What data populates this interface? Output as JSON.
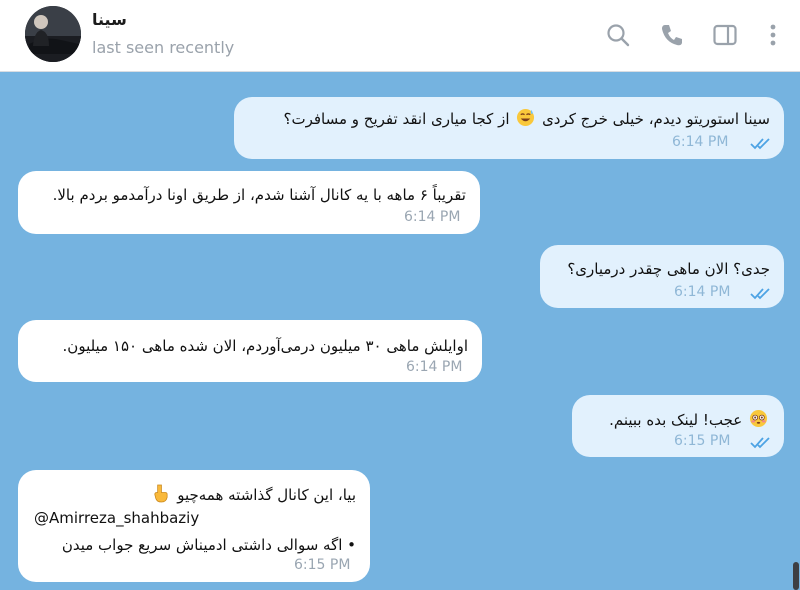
{
  "header": {
    "name": "سینا",
    "status": "last seen recently"
  },
  "messages": [
    {
      "id": "m1",
      "direction": "out",
      "text_before_emoji": "سینا استوریتو دیدم، خیلی خرج کردی",
      "emoji": "sweat-smile",
      "text_after_emoji": "از کجا میاری انقد تفریح و مسافرت؟",
      "time": "6:14 PM",
      "status": "read"
    },
    {
      "id": "m2",
      "direction": "in",
      "line1": "تقریباً ۶ ماهه با یه کانال آشنا شدم، از طریق اونا درآمدمو بردم بالا.",
      "time": "6:14 PM"
    },
    {
      "id": "m3",
      "direction": "out",
      "text": "جدی؟ الان ماهی چقدر درمیاری؟",
      "time": "6:14 PM",
      "status": "read"
    },
    {
      "id": "m4",
      "direction": "in",
      "text": "اوایلش ماهی ۳۰ میلیون درمی‌آوردم، الان شده ماهی ۱۵۰ میلیون.",
      "time": "6:14 PM"
    },
    {
      "id": "m5",
      "direction": "out",
      "emoji": "flushed-face",
      "text": "عجب! لینک بده ببینم.",
      "time": "6:15 PM",
      "status": "read"
    },
    {
      "id": "m6",
      "direction": "in",
      "line1": "بیا، این کانال گذاشته همه‌چیو",
      "emoji": "point-down",
      "link": "@Amirreza_shahbaziy",
      "line3": "• اگه سوالی داشتی ادمیناش سریع جواب میدن",
      "time": "6:15 PM"
    }
  ],
  "colors": {
    "background": "#75b3e0",
    "outgoing_bubble": "#e2f1fd",
    "incoming_bubble": "#ffffff",
    "link": "#2f86c9",
    "read_ticks": "#4da3e4"
  },
  "icons": {
    "search": "search-icon",
    "call": "phone-icon",
    "sidebar": "sidebar-toggle-icon",
    "more": "more-vertical-icon",
    "read": "double-check-icon"
  }
}
